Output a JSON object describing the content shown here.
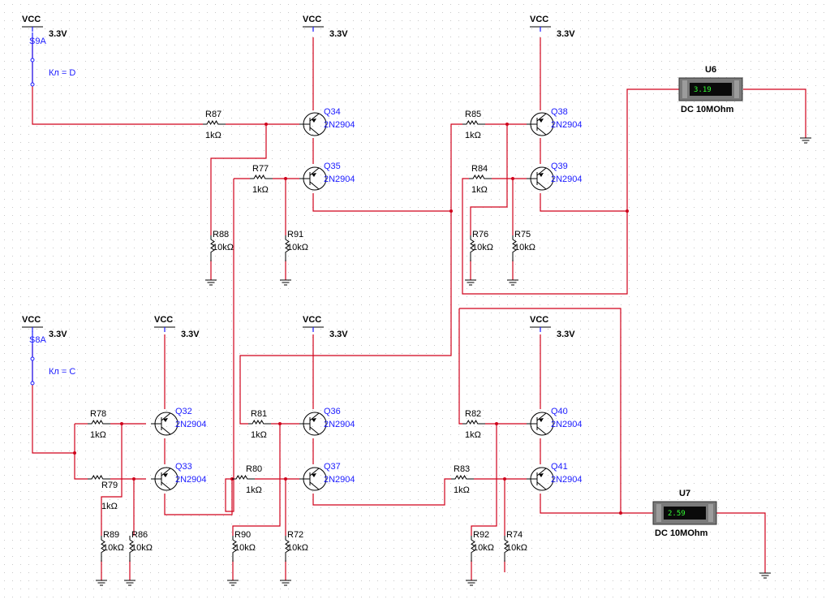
{
  "colors": {
    "wire": "#d0021b",
    "component": "#1a1aff",
    "grid": "#c8c8c8",
    "meter_screen": "#0a0a0a",
    "meter_digits": "#33ff33"
  },
  "supplies": [
    {
      "label": "VCC",
      "voltage": "3.3V"
    },
    {
      "label": "VCC",
      "voltage": "3.3V"
    },
    {
      "label": "VCC",
      "voltage": "3.3V"
    },
    {
      "label": "VCC",
      "voltage": "3.3V"
    },
    {
      "label": "VCC",
      "voltage": "3.3V"
    },
    {
      "label": "VCC",
      "voltage": "3.3V"
    },
    {
      "label": "VCC",
      "voltage": "3.3V"
    }
  ],
  "switches": [
    {
      "name": "S9A",
      "key": "Кл = D"
    },
    {
      "name": "S8A",
      "key": "Кл = C"
    }
  ],
  "transistors": [
    {
      "ref": "Q34",
      "model": "2N2904"
    },
    {
      "ref": "Q35",
      "model": "2N2904"
    },
    {
      "ref": "Q38",
      "model": "2N2904"
    },
    {
      "ref": "Q39",
      "model": "2N2904"
    },
    {
      "ref": "Q32",
      "model": "2N2904"
    },
    {
      "ref": "Q33",
      "model": "2N2904"
    },
    {
      "ref": "Q36",
      "model": "2N2904"
    },
    {
      "ref": "Q37",
      "model": "2N2904"
    },
    {
      "ref": "Q40",
      "model": "2N2904"
    },
    {
      "ref": "Q41",
      "model": "2N2904"
    }
  ],
  "resistors": [
    {
      "ref": "R87",
      "value": "1kΩ"
    },
    {
      "ref": "R77",
      "value": "1kΩ"
    },
    {
      "ref": "R88",
      "value": "10kΩ"
    },
    {
      "ref": "R91",
      "value": "10kΩ"
    },
    {
      "ref": "R85",
      "value": "1kΩ"
    },
    {
      "ref": "R84",
      "value": "1kΩ"
    },
    {
      "ref": "R76",
      "value": "10kΩ"
    },
    {
      "ref": "R75",
      "value": "10kΩ"
    },
    {
      "ref": "R78",
      "value": "1kΩ"
    },
    {
      "ref": "R79",
      "value": "1kΩ"
    },
    {
      "ref": "R89",
      "value": "10kΩ"
    },
    {
      "ref": "R86",
      "value": "10kΩ"
    },
    {
      "ref": "R81",
      "value": "1kΩ"
    },
    {
      "ref": "R80",
      "value": "1kΩ"
    },
    {
      "ref": "R90",
      "value": "10kΩ"
    },
    {
      "ref": "R72",
      "value": "10kΩ"
    },
    {
      "ref": "R82",
      "value": "1kΩ"
    },
    {
      "ref": "R83",
      "value": "1kΩ"
    },
    {
      "ref": "R92",
      "value": "10kΩ"
    },
    {
      "ref": "R74",
      "value": "10kΩ"
    }
  ],
  "meters": [
    {
      "ref": "U6",
      "reading": "3.19",
      "mode": "DC  10MOhm"
    },
    {
      "ref": "U7",
      "reading": "2.59",
      "mode": "DC  10MOhm"
    }
  ]
}
